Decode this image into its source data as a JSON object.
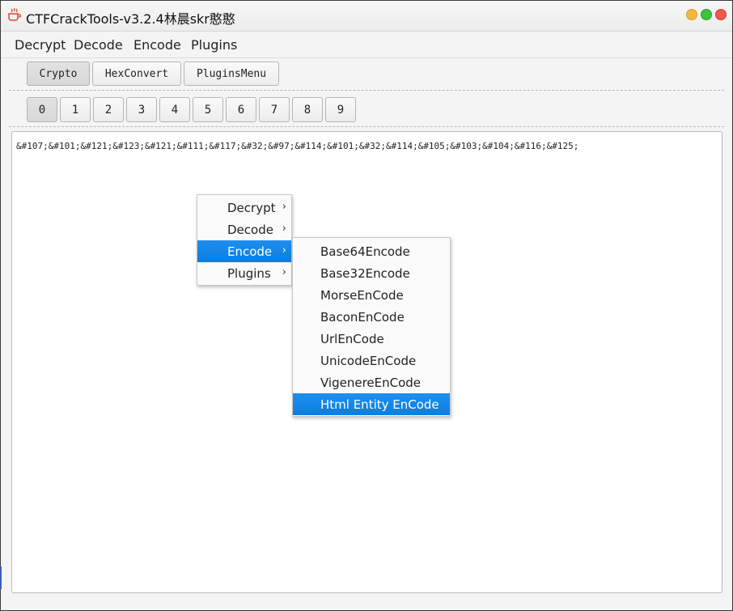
{
  "window": {
    "title": "CTFCrackTools-v3.2.4林晨skr憨憨",
    "icon": "coffee-cup-icon"
  },
  "menubar": {
    "items": [
      "Decrypt",
      "Decode",
      "Encode",
      "Plugins"
    ]
  },
  "tabs": {
    "top": [
      "Crypto",
      "HexConvert",
      "PluginsMenu"
    ],
    "numbers": [
      "0",
      "1",
      "2",
      "3",
      "4",
      "5",
      "6",
      "7",
      "8",
      "9"
    ],
    "selected_top": "Crypto",
    "selected_number": "0"
  },
  "editor": {
    "content": "&#107;&#101;&#121;&#123;&#121;&#111;&#117;&#32;&#97;&#114;&#101;&#32;&#114;&#105;&#103;&#104;&#116;&#125;"
  },
  "context_menu": {
    "items": [
      "Decrypt",
      "Decode",
      "Encode",
      "Plugins"
    ],
    "active": "Encode"
  },
  "encode_submenu": {
    "items": [
      "Base64Encode",
      "Base32Encode",
      "MorseEnCode",
      "BaconEnCode",
      "UrlEnCode",
      "UnicodeEnCode",
      "VigenereEnCode",
      "Html Entity EnCode"
    ],
    "active": "Html Entity EnCode"
  },
  "colors": {
    "accent": "#1e8ff0",
    "traffic_min": "#f5b73b",
    "traffic_max": "#3dc23e",
    "traffic_close": "#f2564e"
  }
}
